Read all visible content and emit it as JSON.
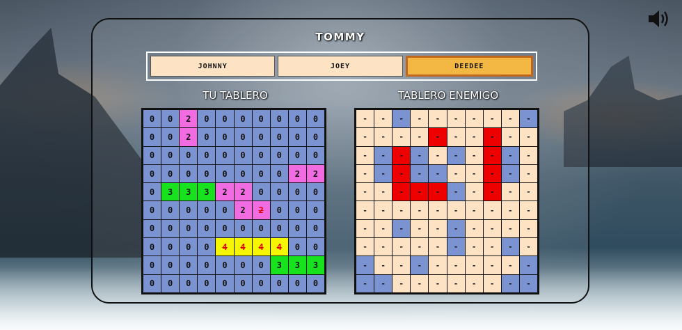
{
  "app": {
    "player_name": "TOMMY"
  },
  "tabs": [
    {
      "label": "JOHNNY",
      "active": false
    },
    {
      "label": "JOEY",
      "active": false
    },
    {
      "label": "DEEDEE",
      "active": true
    }
  ],
  "own_board": {
    "title": "TU TABLERO",
    "rows": [
      [
        [
          "0",
          "w"
        ],
        [
          "0",
          "w"
        ],
        [
          "2",
          "p"
        ],
        [
          "0",
          "w"
        ],
        [
          "0",
          "w"
        ],
        [
          "0",
          "w"
        ],
        [
          "0",
          "w"
        ],
        [
          "0",
          "w"
        ],
        [
          "0",
          "w"
        ],
        [
          "0",
          "w"
        ]
      ],
      [
        [
          "0",
          "w"
        ],
        [
          "0",
          "w"
        ],
        [
          "2",
          "p"
        ],
        [
          "0",
          "w"
        ],
        [
          "0",
          "w"
        ],
        [
          "0",
          "w"
        ],
        [
          "0",
          "w"
        ],
        [
          "0",
          "w"
        ],
        [
          "0",
          "w"
        ],
        [
          "0",
          "w"
        ]
      ],
      [
        [
          "0",
          "w"
        ],
        [
          "0",
          "w"
        ],
        [
          "0",
          "w"
        ],
        [
          "0",
          "w"
        ],
        [
          "0",
          "w"
        ],
        [
          "0",
          "w"
        ],
        [
          "0",
          "w"
        ],
        [
          "0",
          "w"
        ],
        [
          "0",
          "w"
        ],
        [
          "0",
          "w"
        ]
      ],
      [
        [
          "0",
          "w"
        ],
        [
          "0",
          "w"
        ],
        [
          "0",
          "w"
        ],
        [
          "0",
          "w"
        ],
        [
          "0",
          "w"
        ],
        [
          "0",
          "w"
        ],
        [
          "0",
          "w"
        ],
        [
          "0",
          "w"
        ],
        [
          "2",
          "p"
        ],
        [
          "2",
          "p"
        ]
      ],
      [
        [
          "0",
          "w"
        ],
        [
          "3",
          "g"
        ],
        [
          "3",
          "g"
        ],
        [
          "3",
          "g"
        ],
        [
          "2",
          "p"
        ],
        [
          "2",
          "p"
        ],
        [
          "0",
          "w"
        ],
        [
          "0",
          "w"
        ],
        [
          "0",
          "w"
        ],
        [
          "0",
          "w"
        ]
      ],
      [
        [
          "0",
          "w"
        ],
        [
          "0",
          "w"
        ],
        [
          "0",
          "w"
        ],
        [
          "0",
          "w"
        ],
        [
          "0",
          "w"
        ],
        [
          "2",
          "p"
        ],
        [
          "2",
          "ph"
        ],
        [
          "0",
          "w"
        ],
        [
          "0",
          "w"
        ],
        [
          "0",
          "w"
        ]
      ],
      [
        [
          "0",
          "w"
        ],
        [
          "0",
          "w"
        ],
        [
          "0",
          "w"
        ],
        [
          "0",
          "w"
        ],
        [
          "0",
          "w"
        ],
        [
          "0",
          "w"
        ],
        [
          "0",
          "w"
        ],
        [
          "0",
          "w"
        ],
        [
          "0",
          "w"
        ],
        [
          "0",
          "w"
        ]
      ],
      [
        [
          "0",
          "w"
        ],
        [
          "0",
          "w"
        ],
        [
          "0",
          "w"
        ],
        [
          "0",
          "w"
        ],
        [
          "4",
          "yh"
        ],
        [
          "4",
          "yh"
        ],
        [
          "4",
          "yh"
        ],
        [
          "4",
          "yh"
        ],
        [
          "0",
          "w"
        ],
        [
          "0",
          "w"
        ]
      ],
      [
        [
          "0",
          "w"
        ],
        [
          "0",
          "w"
        ],
        [
          "0",
          "w"
        ],
        [
          "0",
          "w"
        ],
        [
          "0",
          "w"
        ],
        [
          "0",
          "w"
        ],
        [
          "0",
          "w"
        ],
        [
          "3",
          "g"
        ],
        [
          "3",
          "g"
        ],
        [
          "3",
          "g"
        ]
      ],
      [
        [
          "0",
          "w"
        ],
        [
          "0",
          "w"
        ],
        [
          "0",
          "w"
        ],
        [
          "0",
          "w"
        ],
        [
          "0",
          "w"
        ],
        [
          "0",
          "w"
        ],
        [
          "0",
          "w"
        ],
        [
          "0",
          "w"
        ],
        [
          "0",
          "w"
        ],
        [
          "0",
          "w"
        ]
      ]
    ]
  },
  "enemy_board": {
    "title": "TABLERO ENEMIGO",
    "rows": [
      [
        [
          "-",
          "c"
        ],
        [
          "-",
          "c"
        ],
        [
          "-",
          "w"
        ],
        [
          "-",
          "c"
        ],
        [
          "-",
          "c"
        ],
        [
          "-",
          "c"
        ],
        [
          "-",
          "c"
        ],
        [
          "-",
          "c"
        ],
        [
          "-",
          "c"
        ],
        [
          "-",
          "w"
        ]
      ],
      [
        [
          "-",
          "c"
        ],
        [
          "-",
          "c"
        ],
        [
          "-",
          "c"
        ],
        [
          "-",
          "c"
        ],
        [
          "-",
          "r"
        ],
        [
          "-",
          "c"
        ],
        [
          "-",
          "c"
        ],
        [
          "-",
          "r"
        ],
        [
          "-",
          "c"
        ],
        [
          "-",
          "c"
        ]
      ],
      [
        [
          "-",
          "c"
        ],
        [
          "-",
          "w"
        ],
        [
          "-",
          "r"
        ],
        [
          "-",
          "w"
        ],
        [
          "-",
          "c"
        ],
        [
          "-",
          "w"
        ],
        [
          "-",
          "c"
        ],
        [
          "-",
          "r"
        ],
        [
          "-",
          "w"
        ],
        [
          "-",
          "c"
        ]
      ],
      [
        [
          "-",
          "c"
        ],
        [
          "-",
          "w"
        ],
        [
          "-",
          "r"
        ],
        [
          "-",
          "w"
        ],
        [
          "-",
          "w"
        ],
        [
          "-",
          "c"
        ],
        [
          "-",
          "c"
        ],
        [
          "-",
          "r"
        ],
        [
          "-",
          "w"
        ],
        [
          "-",
          "c"
        ]
      ],
      [
        [
          "-",
          "c"
        ],
        [
          "-",
          "c"
        ],
        [
          "-",
          "r"
        ],
        [
          "-",
          "r"
        ],
        [
          "-",
          "r"
        ],
        [
          "-",
          "w"
        ],
        [
          "-",
          "c"
        ],
        [
          "-",
          "r"
        ],
        [
          "-",
          "c"
        ],
        [
          "-",
          "c"
        ]
      ],
      [
        [
          "-",
          "c"
        ],
        [
          "-",
          "c"
        ],
        [
          "-",
          "c"
        ],
        [
          "-",
          "c"
        ],
        [
          "-",
          "c"
        ],
        [
          "-",
          "c"
        ],
        [
          "-",
          "c"
        ],
        [
          "-",
          "c"
        ],
        [
          "-",
          "c"
        ],
        [
          "-",
          "c"
        ]
      ],
      [
        [
          "-",
          "c"
        ],
        [
          "-",
          "c"
        ],
        [
          "-",
          "w"
        ],
        [
          "-",
          "c"
        ],
        [
          "-",
          "c"
        ],
        [
          "-",
          "w"
        ],
        [
          "-",
          "c"
        ],
        [
          "-",
          "c"
        ],
        [
          "-",
          "c"
        ],
        [
          "-",
          "c"
        ]
      ],
      [
        [
          "-",
          "c"
        ],
        [
          "-",
          "c"
        ],
        [
          "-",
          "c"
        ],
        [
          "-",
          "c"
        ],
        [
          "-",
          "c"
        ],
        [
          "-",
          "w"
        ],
        [
          "-",
          "c"
        ],
        [
          "-",
          "c"
        ],
        [
          "-",
          "w"
        ],
        [
          "-",
          "c"
        ]
      ],
      [
        [
          "-",
          "w"
        ],
        [
          "-",
          "c"
        ],
        [
          "-",
          "c"
        ],
        [
          "-",
          "w"
        ],
        [
          "-",
          "c"
        ],
        [
          "-",
          "c"
        ],
        [
          "-",
          "c"
        ],
        [
          "-",
          "c"
        ],
        [
          "-",
          "c"
        ],
        [
          "-",
          "w"
        ]
      ],
      [
        [
          "-",
          "w"
        ],
        [
          "-",
          "w"
        ],
        [
          "-",
          "c"
        ],
        [
          "-",
          "c"
        ],
        [
          "-",
          "c"
        ],
        [
          "-",
          "c"
        ],
        [
          "-",
          "c"
        ],
        [
          "-",
          "c"
        ],
        [
          "-",
          "w"
        ],
        [
          "-",
          "w"
        ]
      ]
    ]
  },
  "cell_legend": {
    "w": "water",
    "p": "ship-2",
    "g": "ship-3",
    "y": "ship-4",
    "c": "unknown",
    "r": "hit",
    "h": "damaged"
  },
  "colors": {
    "water": "#7b93d0",
    "ship2": "#f06ce0",
    "ship3": "#18e21d",
    "ship4": "#f6f600",
    "unknown": "#fde3c4",
    "hit": "#ef0000",
    "active_tab": "#f2b843"
  },
  "icons": {
    "sound": "speaker-volume-icon"
  }
}
